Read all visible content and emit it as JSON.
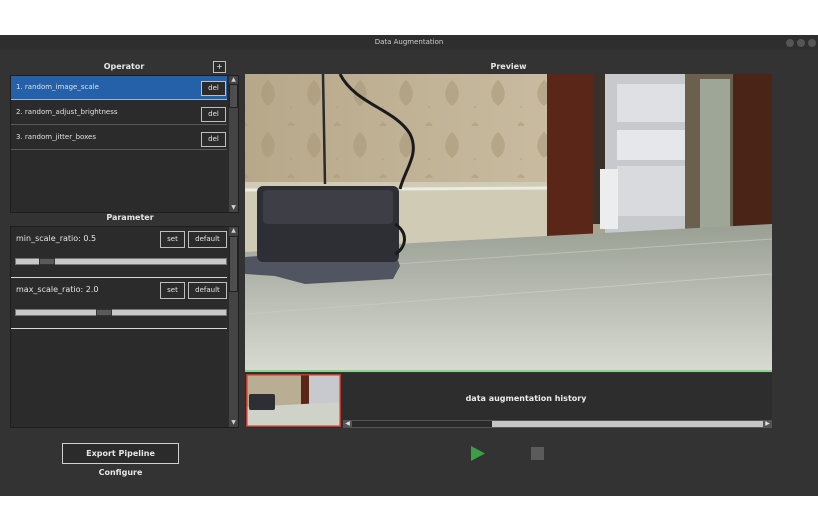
{
  "window": {
    "title": "Data Augmentation"
  },
  "operator": {
    "header": "Operator",
    "add_label": "+",
    "items": [
      {
        "label": "1. random_image_scale",
        "del": "del",
        "selected": true
      },
      {
        "label": "2. random_adjust_brightness",
        "del": "del",
        "selected": false
      },
      {
        "label": "3. random_jitter_boxes",
        "del": "del",
        "selected": false
      }
    ]
  },
  "parameter": {
    "header": "Parameter",
    "items": [
      {
        "label": "min_scale_ratio: 0.5",
        "set": "set",
        "default": "default",
        "slider_value": 0.12
      },
      {
        "label": "max_scale_ratio: 2.0",
        "set": "set",
        "default": "default",
        "slider_value": 0.41
      }
    ]
  },
  "preview": {
    "header": "Preview",
    "history_label": "data augmentation history"
  },
  "footer": {
    "export_label": "Export Pipeline Configure"
  },
  "colors": {
    "accent": "#2461a8",
    "play": "#3aa046",
    "history_border": "#c0392b"
  }
}
